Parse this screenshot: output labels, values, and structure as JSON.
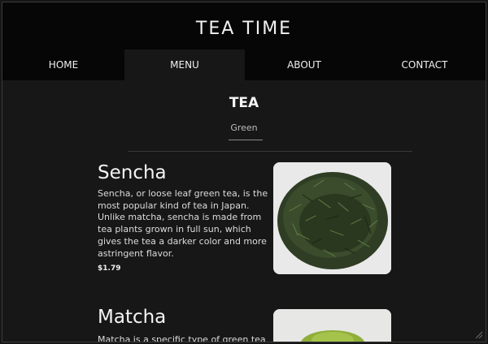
{
  "site": {
    "title": "TEA TIME"
  },
  "nav": [
    {
      "label": "HOME"
    },
    {
      "label": "MENU",
      "active": true
    },
    {
      "label": "ABOUT"
    },
    {
      "label": "CONTACT"
    }
  ],
  "section": {
    "title": "TEA",
    "subtitle": "Green"
  },
  "items": [
    {
      "name": "Sencha",
      "description": "Sencha, or loose leaf green tea, is the most popular kind of tea in Japan. Unlike matcha, sencha is made from tea plants grown in full sun, which gives the tea a darker color and more astringent flavor.",
      "price": "$1.79",
      "image_icon": "sencha-loose-leaf-photo"
    },
    {
      "name": "Matcha",
      "description": "Matcha is a specific type of green tea",
      "image_icon": "matcha-powder-photo"
    }
  ],
  "colors": {
    "background": "#171717",
    "header": "#060606",
    "accent_text": "#f4f4f4"
  }
}
